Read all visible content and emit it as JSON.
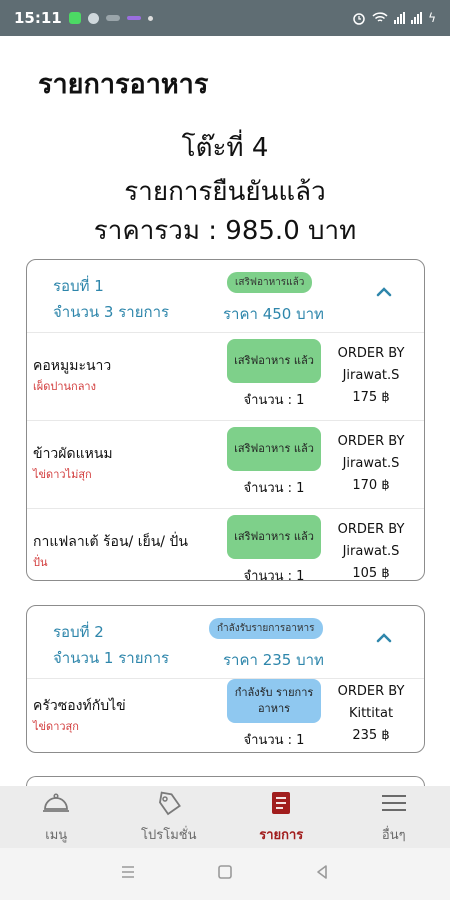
{
  "status_bar": {
    "time": "15:11",
    "battery": "ϟ"
  },
  "header": {
    "title": "รายการอาหาร",
    "table_no": "โต๊ะที่ 4",
    "confirm_text": "รายการยืนยันแล้ว",
    "total_line": "ราคารวม : 985.0 บาท"
  },
  "rounds": [
    {
      "round_label": "รอบที่ 1",
      "count_label": "จำนวน 3 รายการ",
      "status_badge": "เสริฟอาหารแล้ว",
      "price_label": "ราคา 450 บาท",
      "items": [
        {
          "name": "คอหมูมะนาว",
          "note": "เผ็ดปานกลาง",
          "status": "เสริฟอาหาร แล้ว",
          "qty": "จำนวน : 1",
          "order_by_label": "ORDER BY",
          "user": "Jirawat.S",
          "price": "175 ฿"
        },
        {
          "name": "ข้าวผัดแหนม",
          "note": "ไข่ดาวไม่สุก",
          "status": "เสริฟอาหาร แล้ว",
          "qty": "จำนวน : 1",
          "order_by_label": "ORDER BY",
          "user": "Jirawat.S",
          "price": "170 ฿"
        },
        {
          "name": "กาแฟลาเต้ ร้อน/ เย็น/ ปั่น",
          "note": "ปั่น",
          "status": "เสริฟอาหาร แล้ว",
          "qty": "จำนวน : 1",
          "order_by_label": "ORDER BY",
          "user": "Jirawat.S",
          "price": "105 ฿"
        }
      ]
    },
    {
      "round_label": "รอบที่ 2",
      "count_label": "จำนวน 1 รายการ",
      "status_badge": "กำลังรับรายการอาหาร",
      "price_label": "ราคา 235 บาท",
      "items": [
        {
          "name": "ครัวซองท์กับไข่",
          "note": "ไข่ดาวสุก",
          "status": "กำลังรับ รายการอาหาร",
          "qty": "จำนวน : 1",
          "order_by_label": "ORDER BY",
          "user": "Kittitat",
          "price": "235 ฿"
        }
      ]
    }
  ],
  "bottom_nav": {
    "items": [
      {
        "label": "เมนู",
        "icon": "cloche-icon",
        "active": false
      },
      {
        "label": "โปรโมชั่น",
        "icon": "tag-icon",
        "active": false
      },
      {
        "label": "รายการ",
        "icon": "order-list-icon",
        "active": true
      },
      {
        "label": "อื่นๆ",
        "icon": "hamburger-icon",
        "active": false
      }
    ]
  },
  "colors": {
    "accent_blue": "#2e86ab",
    "served_green": "#7ed08a",
    "receiving_blue": "#8fc8f0",
    "note_red": "#d23b3b",
    "active_nav": "#a11d1d"
  }
}
